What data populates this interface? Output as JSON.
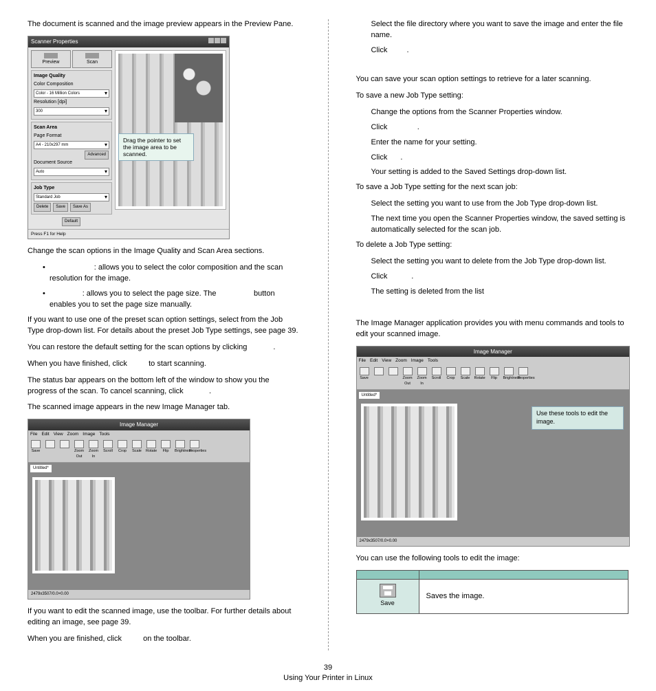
{
  "left": {
    "p1": "The document is scanned and the image preview appears in the Preview Pane.",
    "sp": {
      "title": "Scanner Properties",
      "preview": "Preview",
      "scan": "Scan",
      "g_iq": "Image Quality",
      "cc": "Color Composition",
      "cc_val": "Color - 16 Million Colors",
      "res": "Resolution [dpi]",
      "res_val": "300",
      "g_sa": "Scan Area",
      "pf": "Page Format",
      "pf_val": "A4 - 210x297 mm",
      "adv": "Advanced",
      "ds": "Document Source",
      "ds_val": "Auto",
      "g_jt": "Job Type",
      "jt_val": "Standard Job",
      "del": "Delete",
      "save": "Save",
      "saveas": "Save As",
      "def": "Default",
      "status": "Press F1 for Help",
      "callout": "Drag the pointer to set the image area to be scanned."
    },
    "p2": "Change the scan options in the Image Quality and Scan Area sections.",
    "b1": ": allows you to select the color composition and the scan resolution for the image.",
    "b2a": ": allows you to select the page size. The",
    "b2b": "button enables you to set the page size manually.",
    "p3": "If you want to use one of the preset scan option settings, select from the Job Type drop-down list. For details about the preset Job Type settings, see page 39.",
    "p4": "You can restore the default setting for the scan options by clicking",
    "p4b": ".",
    "p5a": "When you have finished, click",
    "p5b": "to start scanning.",
    "p6a": "The status bar appears on the bottom left of the window to show you the progress of the scan. To cancel scanning, click",
    "p6b": ".",
    "p7": "The scanned image appears in the new Image Manager tab.",
    "im": {
      "title": "Image Manager",
      "menu": [
        "File",
        "Edit",
        "View",
        "Zoom",
        "Image",
        "Tools"
      ],
      "tools": [
        "Save",
        "",
        "",
        "Zoom Out",
        "Zoom In",
        "Scroll",
        "Crop",
        "Scale",
        "Rotate",
        "Flip",
        "Brightness",
        "Properties"
      ],
      "tab": "Untitled*",
      "status": "2479x3507/0.0×0.00"
    },
    "p8": "If you want to edit the scanned image, use the toolbar. For further details about editing an image, see page 39.",
    "p9a": "When you are finished, click",
    "p9b": "on the toolbar."
  },
  "right": {
    "p1": "Select the file directory where you want to save the image and enter the file name.",
    "p2a": "Click",
    "p2b": ".",
    "p3": "You can save your scan option settings to retrieve for a later scanning.",
    "p4": "To save a new Job Type setting:",
    "s1": "Change the options from the Scanner Properties window.",
    "s2a": "Click",
    "s2b": ".",
    "s3": "Enter the name for your setting.",
    "s4a": "Click",
    "s4b": ".",
    "s5": "Your setting is added to the Saved Settings drop-down list.",
    "p5": "To save a Job Type setting for the next scan job:",
    "s6": "Select the setting you want to use from the Job Type drop-down list.",
    "s7": "The next time you open the Scanner Properties window, the saved setting is automatically selected for the scan job.",
    "p6": "To delete a Job Type setting:",
    "s8": "Select the setting you want to delete from the Job Type drop-down list.",
    "s9a": "Click",
    "s9b": ".",
    "s10": "The setting is deleted from the list",
    "p7": "The Image Manager application provides you with menu commands and tools to edit your scanned image.",
    "im": {
      "title": "Image Manager",
      "callout": "Use these tools to edit the image."
    },
    "p8": "You can use the following tools to edit the image:",
    "tbl": {
      "h1": "",
      "h2": "",
      "save_lbl": "Save",
      "save_desc": "Saves the image."
    }
  },
  "footer": {
    "page": "39",
    "title": "Using Your Printer in Linux"
  }
}
